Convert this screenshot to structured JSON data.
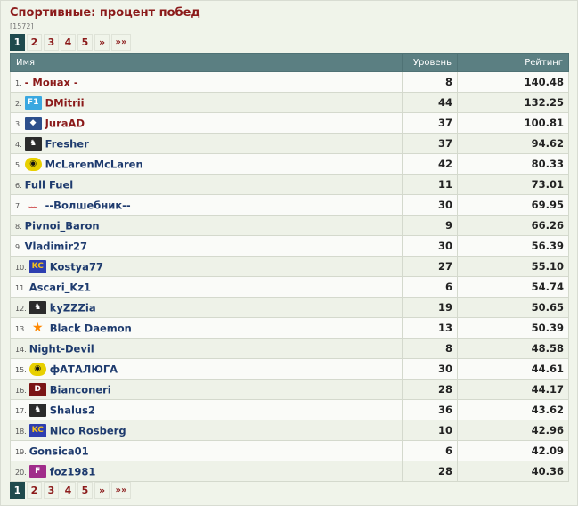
{
  "title": "Спортивные: процент побед",
  "total": "[1572]",
  "pager": {
    "pages": [
      "1",
      "2",
      "3",
      "4",
      "5"
    ],
    "current": "1",
    "next": "»",
    "last": "»»"
  },
  "table": {
    "headers": {
      "name": "Имя",
      "level": "Уровень",
      "rating": "Рейтинг"
    },
    "rows": [
      {
        "index": "1.",
        "badge": "",
        "name": "- Монах -",
        "level": "8",
        "rating": "140.48",
        "highlight": true
      },
      {
        "index": "2.",
        "badge": "F1",
        "name": "DMitrii",
        "level": "44",
        "rating": "132.25",
        "highlight": true
      },
      {
        "index": "3.",
        "badge": "ford",
        "name": "JuraAD",
        "level": "37",
        "rating": "100.81",
        "highlight": true
      },
      {
        "index": "4.",
        "badge": "horse",
        "name": "Fresher",
        "level": "37",
        "rating": "94.62",
        "highlight": false
      },
      {
        "index": "5.",
        "badge": "mclaren",
        "name": "McLarenMcLaren",
        "level": "42",
        "rating": "80.33",
        "highlight": false
      },
      {
        "index": "6.",
        "badge": "",
        "name": "Full Fuel",
        "level": "11",
        "rating": "73.01",
        "highlight": false
      },
      {
        "index": "7.",
        "badge": "dash",
        "name": "--Волшебник--",
        "level": "30",
        "rating": "69.95",
        "highlight": false
      },
      {
        "index": "8.",
        "badge": "",
        "name": "Pivnoi_Baron",
        "level": "9",
        "rating": "66.26",
        "highlight": false
      },
      {
        "index": "9.",
        "badge": "",
        "name": "Vladimir27",
        "level": "30",
        "rating": "56.39",
        "highlight": false
      },
      {
        "index": "10.",
        "badge": "kc",
        "name": "Kostya77",
        "level": "27",
        "rating": "55.10",
        "highlight": false
      },
      {
        "index": "11.",
        "badge": "",
        "name": "Ascari_Kz1",
        "level": "6",
        "rating": "54.74",
        "highlight": false
      },
      {
        "index": "12.",
        "badge": "horse",
        "name": "kyZZZia",
        "level": "19",
        "rating": "50.65",
        "highlight": false
      },
      {
        "index": "13.",
        "badge": "star",
        "name": "Black Daemon",
        "level": "13",
        "rating": "50.39",
        "highlight": false
      },
      {
        "index": "14.",
        "badge": "",
        "name": "Night-Devil",
        "level": "8",
        "rating": "48.58",
        "highlight": false
      },
      {
        "index": "15.",
        "badge": "mclaren",
        "name": "фАТАЛЮГА",
        "level": "30",
        "rating": "44.61",
        "highlight": false
      },
      {
        "index": "16.",
        "badge": "d",
        "name": "Bianconeri",
        "level": "28",
        "rating": "44.17",
        "highlight": false
      },
      {
        "index": "17.",
        "badge": "horse",
        "name": "Shalus2",
        "level": "36",
        "rating": "43.62",
        "highlight": false
      },
      {
        "index": "18.",
        "badge": "kc",
        "name": "Nico Rosberg",
        "level": "10",
        "rating": "42.96",
        "highlight": false
      },
      {
        "index": "19.",
        "badge": "",
        "name": "Gonsica01",
        "level": "6",
        "rating": "42.09",
        "highlight": false
      },
      {
        "index": "20.",
        "badge": "f",
        "name": "foz1981",
        "level": "28",
        "rating": "40.36",
        "highlight": false
      }
    ]
  },
  "colors": {
    "title": "#8b1a1a",
    "header_bg": "#5b7f82",
    "current_page_bg": "#1f4a4d",
    "name_link": "#1e3b6e"
  }
}
